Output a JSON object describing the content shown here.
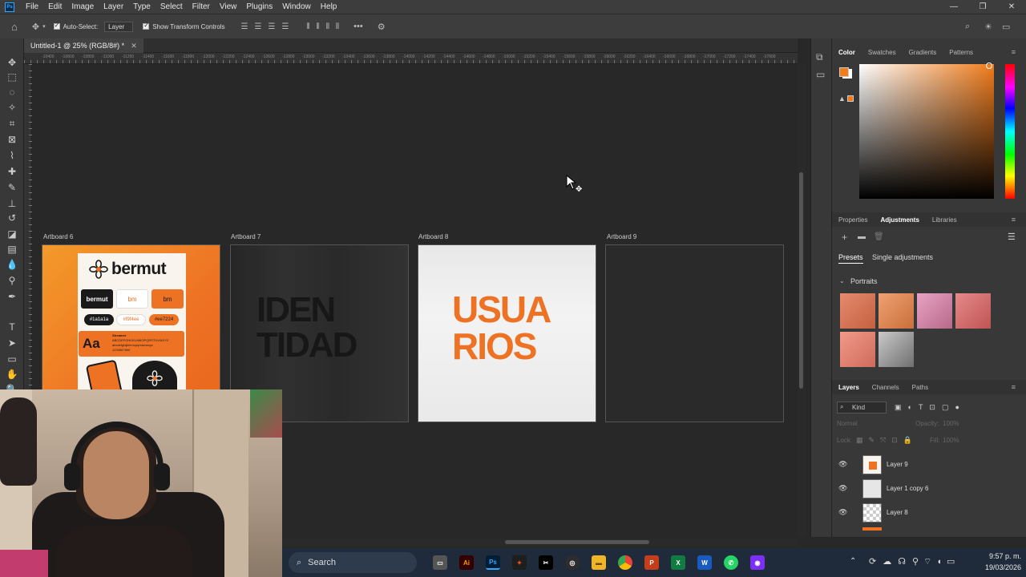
{
  "menubar": {
    "logo": "Ps",
    "items": [
      "File",
      "Edit",
      "Image",
      "Layer",
      "Type",
      "Select",
      "Filter",
      "View",
      "Plugins",
      "Window",
      "Help"
    ]
  },
  "options": {
    "auto_select_label": "Auto-Select:",
    "auto_select_target": "Layer",
    "show_transform_label": "Show Transform Controls"
  },
  "document": {
    "tab_title": "Untitled-1 @ 25% (RGB/8#) *",
    "ruler_labels": [
      "-10400",
      "-10600",
      "-10800",
      "-11000",
      "-11200",
      "-11400",
      "-11600",
      "-11800",
      "-12000",
      "-12200",
      "-12400",
      "-12600",
      "-12800",
      "-13000",
      "-13200",
      "-13400",
      "-13600",
      "-13800",
      "-14000",
      "-14200",
      "-14400",
      "-14600",
      "-14800",
      "-15000",
      "-15200",
      "-15400",
      "-15600",
      "-15800",
      "-16000",
      "-16200",
      "-16400",
      "-16600",
      "-16800",
      "-17000",
      "-17200",
      "-17400",
      "-17600"
    ]
  },
  "artboards": [
    {
      "label": "Artboard 6"
    },
    {
      "label": "Artboard 7"
    },
    {
      "label": "Artboard 8"
    },
    {
      "label": "Artboard 9"
    }
  ],
  "artboard6": {
    "brand": "bermut",
    "chip_dark": "bermut",
    "chip_light": "bm",
    "chip_orange": "bm",
    "hex_dark": "#1a1a1a",
    "hex_light": "#f9f4ee",
    "hex_orange": "#ee7224",
    "type_sample": "Aa",
    "type_name": "Streamer",
    "alphabet_upper": "ABCDEFGHIJKLMNOPQRSTUVWXYZ",
    "alphabet_lower": "abcdefghijklmnopqrstuvwxyz",
    "digits": "1234567890"
  },
  "artboard7": {
    "line1": "IDEN",
    "line2": "TIDAD"
  },
  "artboard8": {
    "line1": "USUA",
    "line2": "RIOS"
  },
  "color_panel": {
    "tabs": [
      "Color",
      "Swatches",
      "Gradients",
      "Patterns"
    ],
    "foreground": "#f07c1c",
    "background": "#ffffff"
  },
  "adjust_panel": {
    "tabs": [
      "Properties",
      "Adjustments",
      "Libraries"
    ],
    "subtabs": [
      "Presets",
      "Single adjustments"
    ],
    "group": "Portraits"
  },
  "layers_panel": {
    "tabs": [
      "Layers",
      "Channels",
      "Paths"
    ],
    "filter_kind": "Kind",
    "blend_mode": "Normal",
    "opacity_label": "Opacity:",
    "opacity_value": "100%",
    "lock_label": "Lock:",
    "fill_label": "Fill:",
    "fill_value": "100%",
    "layers": [
      {
        "name": "Layer 9"
      },
      {
        "name": "Layer 1 copy 6"
      },
      {
        "name": "Layer 8"
      }
    ]
  },
  "taskbar": {
    "search_placeholder": "Search",
    "time": "9:57 p. m.",
    "date": "19/03/2026"
  },
  "colors": {
    "accent_orange": "#ee7224",
    "ps_blue": "#31a8ff"
  }
}
